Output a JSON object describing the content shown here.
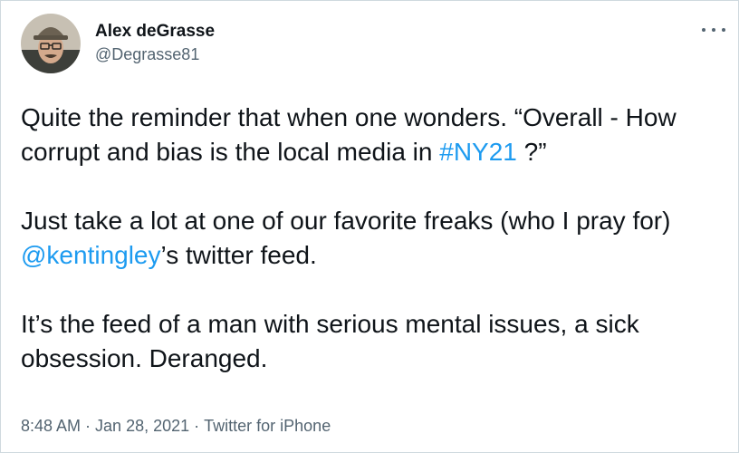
{
  "author": {
    "display_name": "Alex deGrasse",
    "handle": "@Degrasse81",
    "avatar_icon": "user-avatar-photo"
  },
  "menu": {
    "icon": "more-options-icon"
  },
  "tweet": {
    "p1_before": "Quite the reminder that when one wonders. “Overall - How corrupt and bias is the local media in ",
    "p1_hashtag": "#NY21",
    "p1_after": " ?”",
    "p2_before": "Just take a lot at one of our favorite freaks (who I pray for) ",
    "p2_mention": "@kentingley",
    "p2_after": "’s twitter feed.",
    "p3": "It’s the feed of a man with serious mental issues, a sick obsession. Deranged."
  },
  "meta": {
    "time": "8:48 AM",
    "date": "Jan 28, 2021",
    "source": "Twitter for iPhone",
    "separator": "·"
  },
  "colors": {
    "link": "#1d9bf0",
    "secondary_text": "#536471",
    "primary_text": "#0f1419",
    "border": "#cfd9de"
  }
}
